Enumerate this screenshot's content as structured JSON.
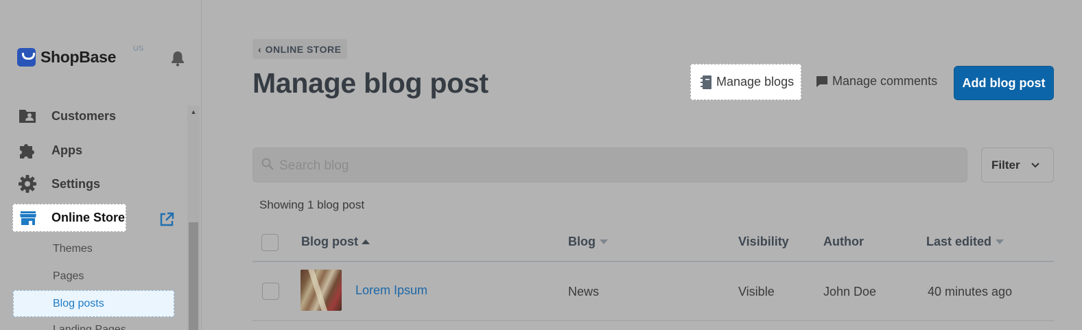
{
  "brand": {
    "name": "ShopBase",
    "region": "US"
  },
  "sidebar": {
    "items": [
      {
        "label": "Customers",
        "icon": "customers-icon"
      },
      {
        "label": "Apps",
        "icon": "puzzle-icon"
      },
      {
        "label": "Settings",
        "icon": "gear-icon"
      },
      {
        "label": "Online Store",
        "icon": "store-icon"
      }
    ],
    "subitems": [
      "Themes",
      "Pages",
      "Blog posts",
      "Landing Pages"
    ]
  },
  "header": {
    "breadcrumb": "ONLINE STORE",
    "title": "Manage blog post",
    "manage_blogs": "Manage blogs",
    "manage_comments": "Manage comments",
    "add_post": "Add blog post"
  },
  "search": {
    "placeholder": "Search blog"
  },
  "filter": {
    "label": "Filter"
  },
  "showing": "Showing 1 blog post",
  "table": {
    "columns": [
      "Blog post",
      "Blog",
      "Visibility",
      "Author",
      "Last edited"
    ],
    "rows": [
      {
        "title": "Lorem Ipsum",
        "blog": "News",
        "visibility": "Visible",
        "author": "John Doe",
        "edited": "40 minutes ago"
      }
    ]
  },
  "colors": {
    "accent": "#0c65a8",
    "link": "#1f7bc4",
    "overlay": "#b3b3b3"
  }
}
